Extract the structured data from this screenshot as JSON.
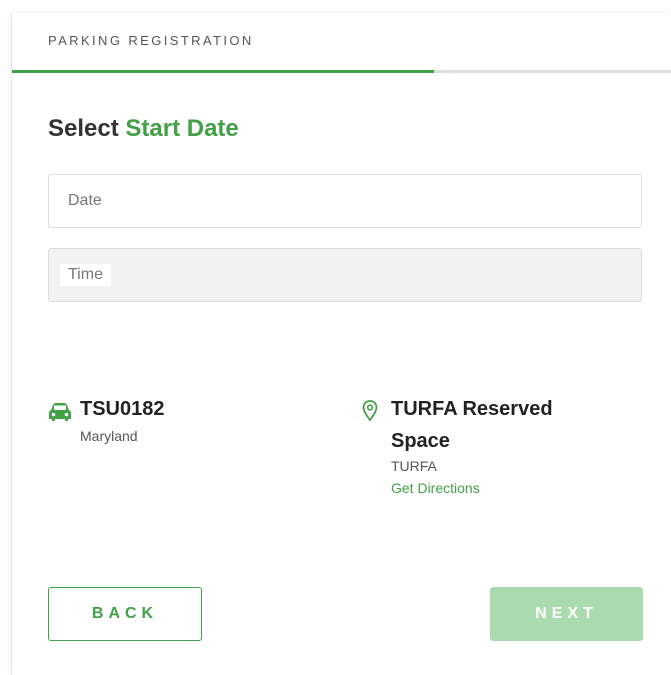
{
  "header": {
    "title": "PARKING REGISTRATION"
  },
  "progress": {
    "fraction": 0.64,
    "fill_color": "#43a047",
    "track_color": "#e0e0e0"
  },
  "page": {
    "title_prefix": "Select",
    "title_accent": "Start Date"
  },
  "form": {
    "date": {
      "placeholder": "Date"
    },
    "time": {
      "placeholder": "Time"
    }
  },
  "vehicle": {
    "icon": "car-icon",
    "plate": "TSU0182",
    "state": "Maryland"
  },
  "location": {
    "icon": "map-pin-icon",
    "name": "TURFA Reserved Space",
    "code": "TURFA",
    "directions_label": "Get Directions"
  },
  "buttons": {
    "back": "BACK",
    "next": "NEXT"
  },
  "colors": {
    "accent": "#43a047",
    "next_disabled": "#a9dbae"
  }
}
